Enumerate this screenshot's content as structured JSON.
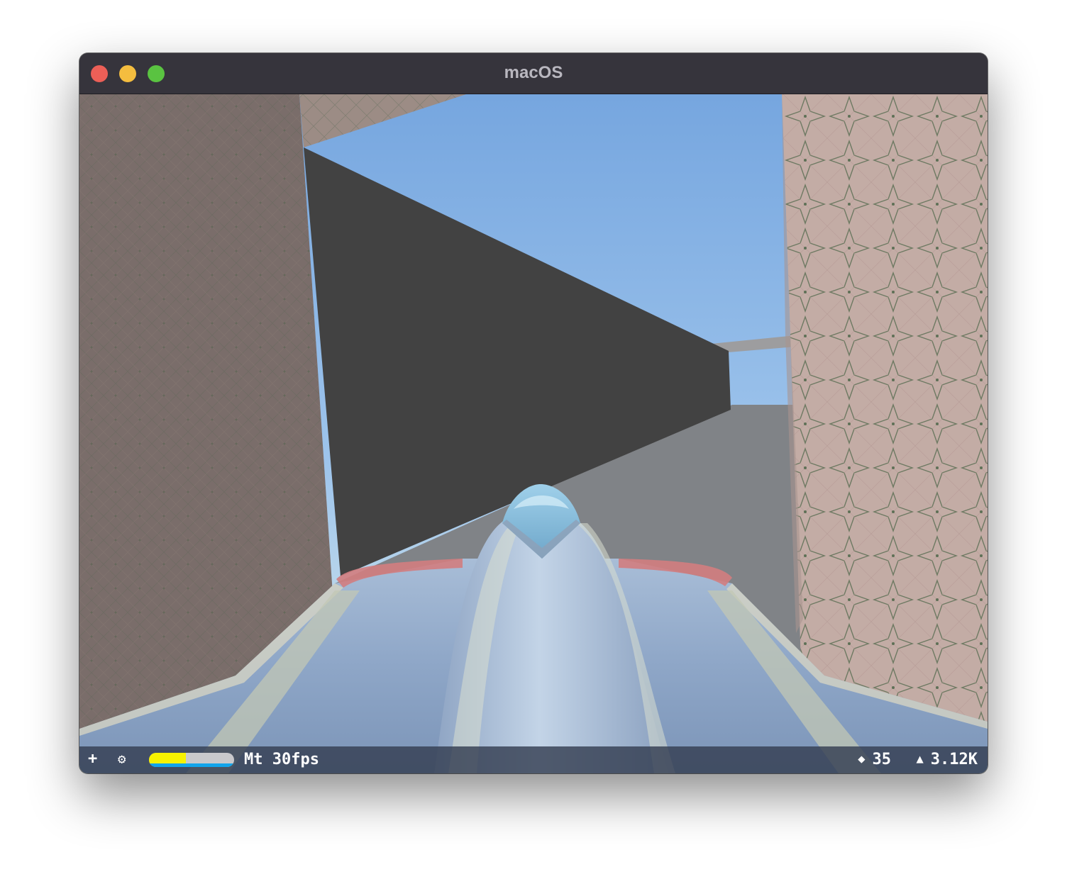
{
  "window": {
    "title": "macOS"
  },
  "statusbar": {
    "add_label": "+",
    "settings_label": "⚙",
    "meter_level": 0.43,
    "fps_label": "Mt 30fps",
    "nodes_icon": "diamond-icon",
    "nodes_value": "35",
    "triangles_icon": "triangle-icon",
    "triangles_value": "3.12K"
  },
  "colors": {
    "sky_top": "#79a8de",
    "sky_bottom": "#aed0ee",
    "dark_wall": "#424242",
    "floor": "#808387",
    "left_wall": "#7c6f6b",
    "right_wall": "#c2aca6",
    "ship_body": "#8fa7c6",
    "ship_stripe": "#d67a7a"
  }
}
